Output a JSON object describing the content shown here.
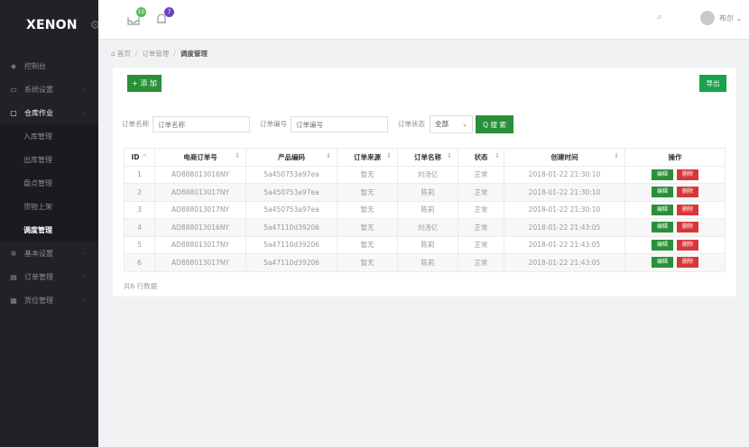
{
  "app": {
    "logo": "XENON"
  },
  "sidebar": {
    "items": [
      {
        "icon": "dashboard-icon",
        "label": "控制台",
        "open": false,
        "arrow": false
      },
      {
        "icon": "monitor-icon",
        "label": "系统设置",
        "open": false,
        "arrow": true
      },
      {
        "icon": "warehouse-icon",
        "label": "仓库作业",
        "open": true,
        "arrow": true
      }
    ],
    "subitems": [
      {
        "label": "入库管理",
        "active": false
      },
      {
        "label": "出库管理",
        "active": false
      },
      {
        "label": "盘点管理",
        "active": false
      },
      {
        "label": "货物上架",
        "active": false
      },
      {
        "label": "调度管理",
        "active": true
      }
    ],
    "bottom_items": [
      {
        "icon": "settings-icon",
        "label": "基本设置"
      },
      {
        "icon": "order-icon",
        "label": "订单管理"
      },
      {
        "icon": "location-icon",
        "label": "货位管理"
      }
    ]
  },
  "topbar": {
    "notif_badge": "15",
    "msg_badge": "7",
    "user_name": "布尔"
  },
  "breadcrumb": {
    "home": "首页",
    "level1": "订单管理",
    "current": "调度管理"
  },
  "toolbar": {
    "add_label": "+ 添 加",
    "export_label": "导出"
  },
  "filters": {
    "order_name_label": "订单名称",
    "order_name_placeholder": "订单名称",
    "order_no_label": "订单编号",
    "order_no_placeholder": "订单编号",
    "status_label": "订单状态",
    "status_value": "全部",
    "search_label": "Q 搜 索"
  },
  "table": {
    "headers": [
      "ID",
      "电商订单号",
      "产品编码",
      "订单来源",
      "订单名称",
      "状态",
      "创建时间",
      "操作"
    ],
    "rows": [
      [
        "1",
        "AD888013016NY",
        "5a450753a97ea",
        "暂无",
        "刘汤亿",
        "正常",
        "2018-01-22 21:30:10"
      ],
      [
        "2",
        "AD888013017NY",
        "5a450753a97ea",
        "暂无",
        "陈莉",
        "正常",
        "2018-01-22 21:30:10"
      ],
      [
        "3",
        "AD888013017NY",
        "5a450753a97ea",
        "暂无",
        "陈莉",
        "正常",
        "2018-01-22 21:30:10"
      ],
      [
        "4",
        "AD888013016NY",
        "5a47110d39206",
        "暂无",
        "刘汤亿",
        "正常",
        "2018-01-22 21:43:05"
      ],
      [
        "5",
        "AD888013017NY",
        "5a47110d39206",
        "暂无",
        "陈莉",
        "正常",
        "2018-01-22 21:43:05"
      ],
      [
        "6",
        "AD888013017NY",
        "5a47110d39206",
        "暂无",
        "陈莉",
        "正常",
        "2018-01-22 21:43:05"
      ]
    ],
    "edit_label": "编辑",
    "delete_label": "删除"
  },
  "footer": {
    "total": "共6 行数据"
  },
  "colors": {
    "sidebar_bg": "#212227",
    "primary_green": "#2a8f38",
    "danger_red": "#d9363a",
    "badge_green": "#5bb75b",
    "badge_purple": "#6f42c1"
  }
}
